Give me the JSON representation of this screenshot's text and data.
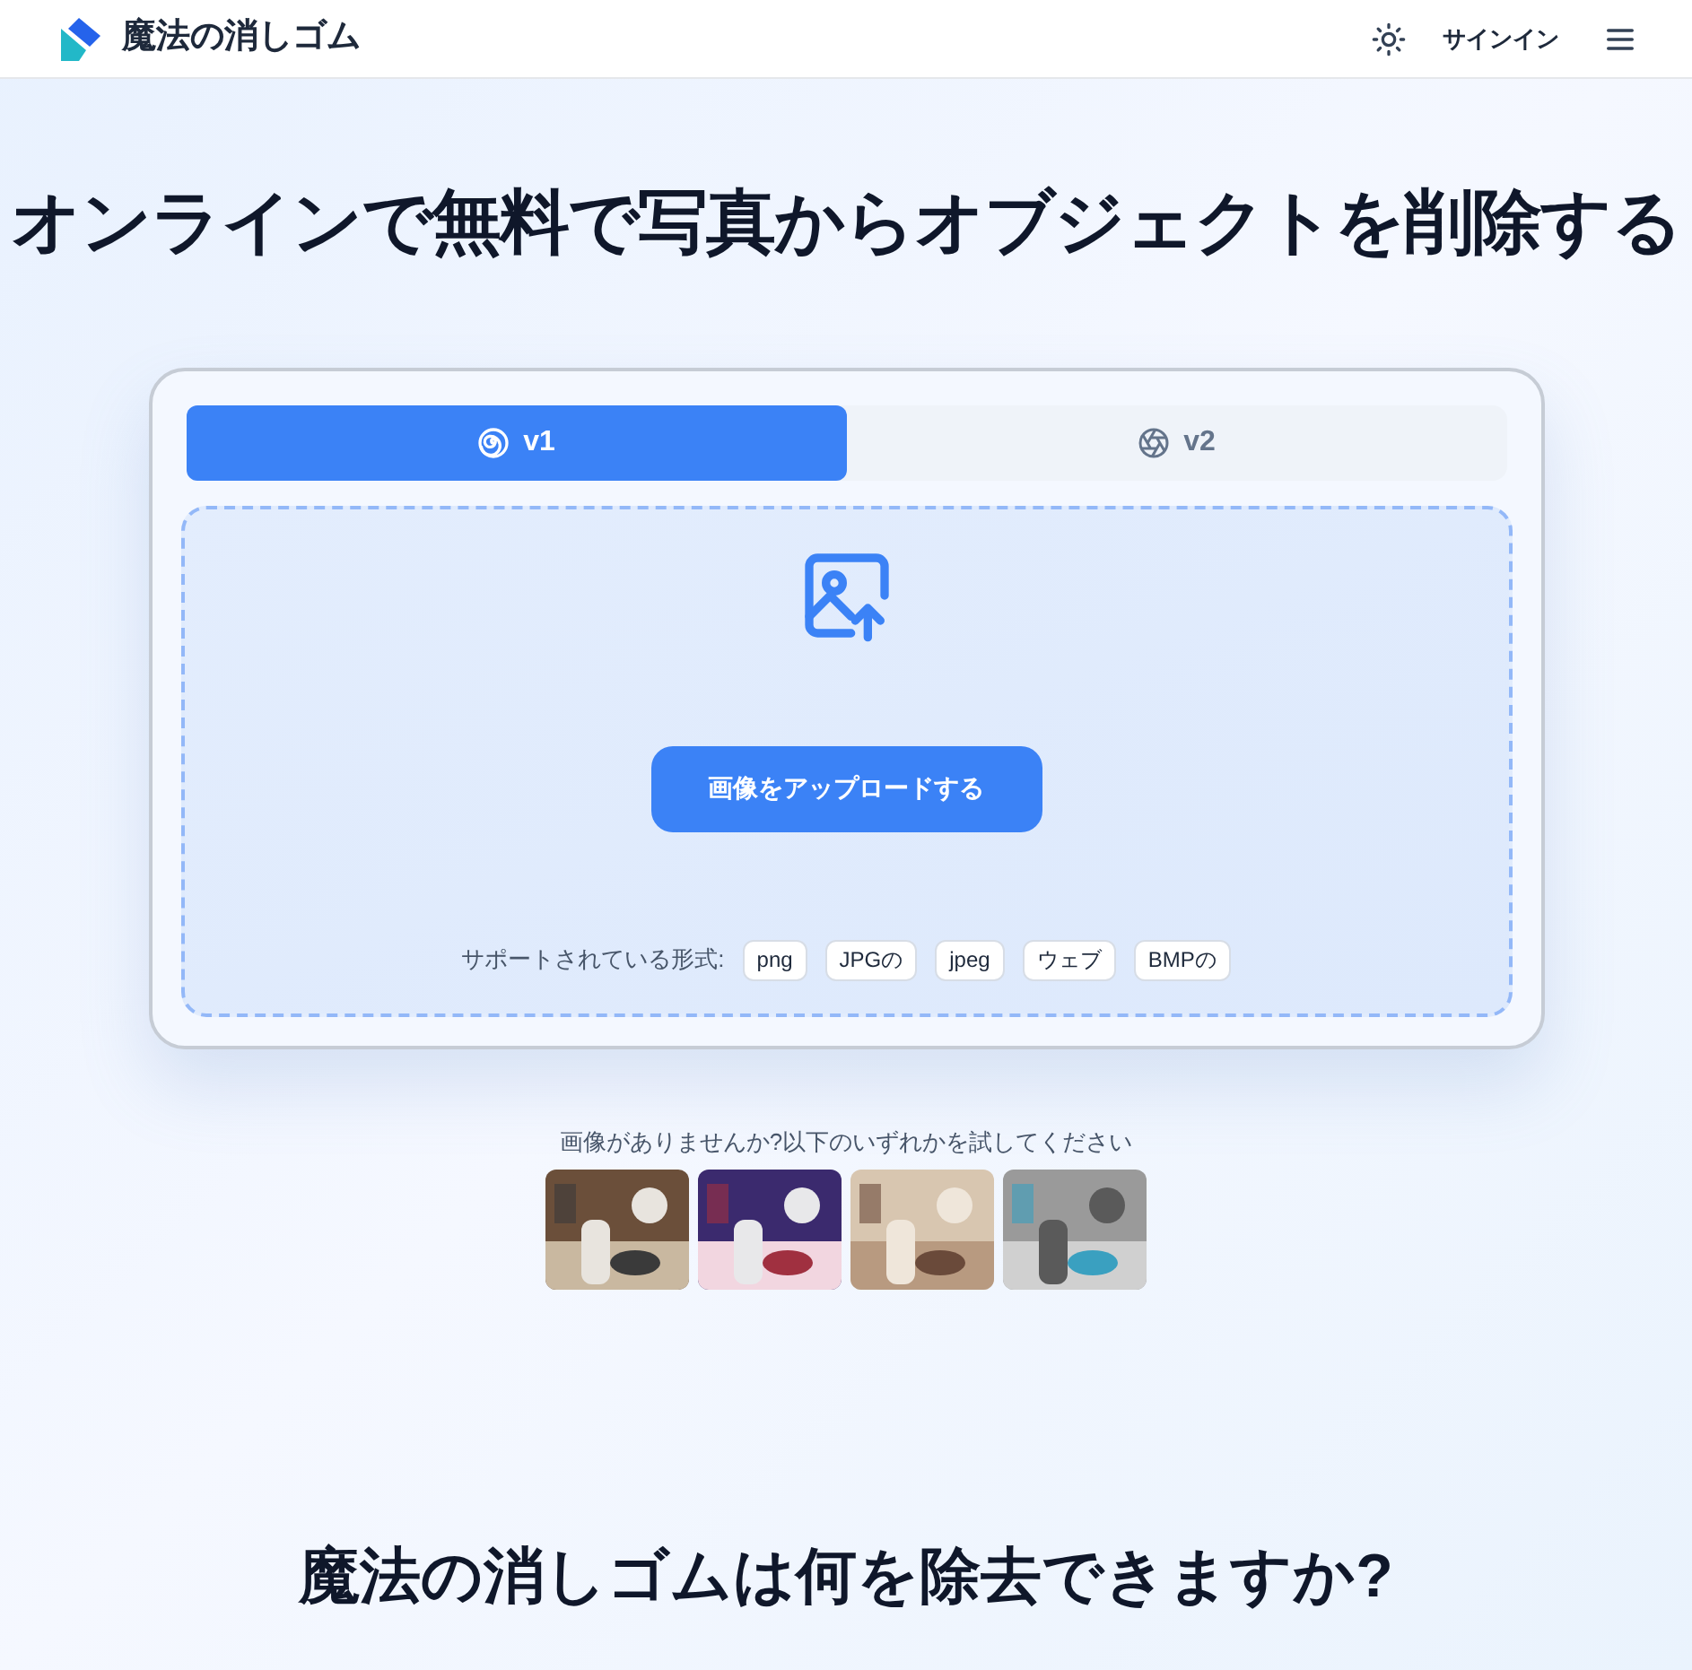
{
  "header": {
    "brand": "魔法の消しゴム",
    "sign_in": "サインイン"
  },
  "title": "オンラインで無料で写真からオブジェクトを削除する",
  "tabs": [
    {
      "label": "v1",
      "selected": true,
      "kind": "spiral"
    },
    {
      "label": "v2",
      "selected": false,
      "kind": "aperture"
    }
  ],
  "upload": {
    "button": "画像をアップロードする",
    "formats_label": "サポートされている形式:",
    "formats": [
      "png",
      "JPGの",
      "jpeg",
      "ウェブ",
      "BMPの"
    ]
  },
  "samples": {
    "prompt": "画像がありませんか?以下のいずれかを試してください"
  },
  "section_title": "魔法の消しゴムは何を除去できますか?"
}
